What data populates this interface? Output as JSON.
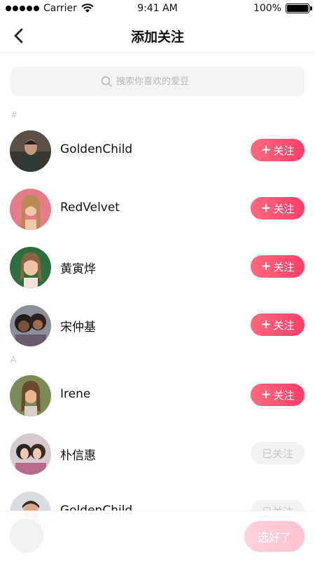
{
  "status_bar": {
    "carrier": "Carrier",
    "time": "9:41 AM",
    "battery": "100%"
  },
  "nav": {
    "title": "添加关注"
  },
  "search": {
    "placeholder": "搜索你喜欢的爱豆"
  },
  "sections": [
    "#",
    "A"
  ],
  "idols": [
    {
      "name": "GoldenChild",
      "button": "关注",
      "followed": false
    },
    {
      "name": "RedVelvet",
      "button": "关注",
      "followed": false
    },
    {
      "name": "黄寅烨",
      "button": "关注",
      "followed": false
    },
    {
      "name": "宋仲基",
      "button": "关注",
      "followed": false
    },
    {
      "name": "Irene",
      "button": "关注",
      "followed": false
    },
    {
      "name": "朴信惠",
      "button": "已关注",
      "followed": true
    },
    {
      "name": "GoldenChild",
      "button": "已关注",
      "followed": true
    }
  ],
  "bottom": {
    "confirm_label": "选好了"
  },
  "colors": {
    "accent_start": "#ff6a7d",
    "accent_end": "#fb3e6a"
  }
}
